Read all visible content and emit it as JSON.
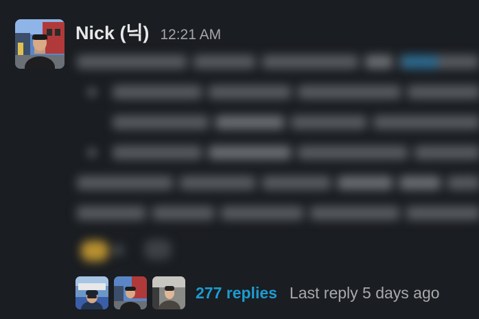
{
  "message": {
    "author": "Nick (닉)",
    "timestamp": "12:21 AM"
  },
  "thread": {
    "reply_count": "277 replies",
    "last_reply": "Last reply 5 days ago"
  },
  "colors": {
    "background": "#1a1d21",
    "link": "#1d9bd1",
    "author": "#e8e8e8",
    "muted": "#a8a9ab"
  }
}
